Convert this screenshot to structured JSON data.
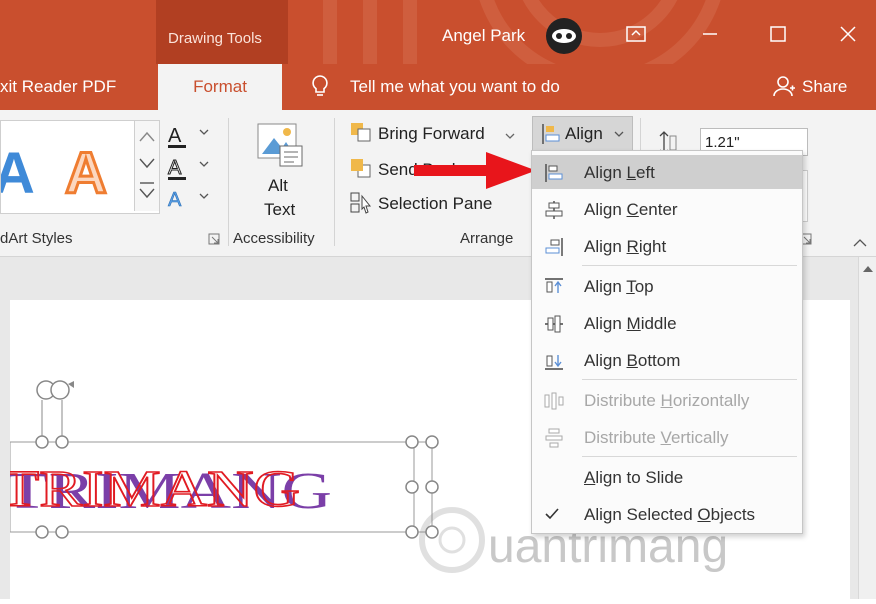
{
  "titlebar": {
    "context_tab": "Drawing Tools",
    "user_name": "Angel Park",
    "buttons": [
      "ribbon-display",
      "minimize",
      "maximize",
      "close"
    ]
  },
  "tabs": {
    "left_partial": "xit Reader PDF",
    "format": "Format",
    "tell_me": "Tell me what you want to do",
    "share": "Share"
  },
  "ribbon": {
    "wordart_group_label": "dArt Styles",
    "accessibility_group_label": "Accessibility",
    "alt_text_line1": "Alt",
    "alt_text_line2": "Text",
    "bring_forward": "Bring Forward",
    "send_backward": "Send Backward",
    "selection_pane": "Selection Pane",
    "arrange_group_label": "Arrange",
    "align_button": "Align",
    "size_value": "1.21\""
  },
  "align_menu": {
    "items": [
      {
        "label": "Align Left",
        "underline": "L",
        "enabled": true,
        "highlighted": true,
        "icon": "align-left-icon"
      },
      {
        "label": "Align Center",
        "underline": "C",
        "enabled": true,
        "icon": "align-center-icon"
      },
      {
        "label": "Align Right",
        "underline": "R",
        "enabled": true,
        "icon": "align-right-icon"
      },
      {
        "label": "Align Top",
        "underline": "T",
        "enabled": true,
        "icon": "align-top-icon"
      },
      {
        "label": "Align Middle",
        "underline": "M",
        "enabled": true,
        "icon": "align-middle-icon"
      },
      {
        "label": "Align Bottom",
        "underline": "B",
        "enabled": true,
        "icon": "align-bottom-icon"
      },
      {
        "label": "Distribute Horizontally",
        "underline": "H",
        "enabled": false,
        "icon": "distribute-horizontally-icon"
      },
      {
        "label": "Distribute Vertically",
        "underline": "V",
        "enabled": false,
        "icon": "distribute-vertically-icon"
      },
      {
        "label": "Align to Slide",
        "underline": "A",
        "enabled": true,
        "icon": ""
      },
      {
        "label": "Align Selected Objects",
        "underline": "O",
        "enabled": true,
        "checked": true,
        "icon": "checkmark-icon"
      }
    ]
  },
  "slide": {
    "wordart_text": "TRIMANG",
    "watermark_text": "uantrimang"
  },
  "colors": {
    "accent": "#c94f2e",
    "ribbon_bg": "#f3f3f3",
    "arrow": "#e8151b",
    "text_red": "#e11b22",
    "text_purple": "#7b3fa8"
  }
}
